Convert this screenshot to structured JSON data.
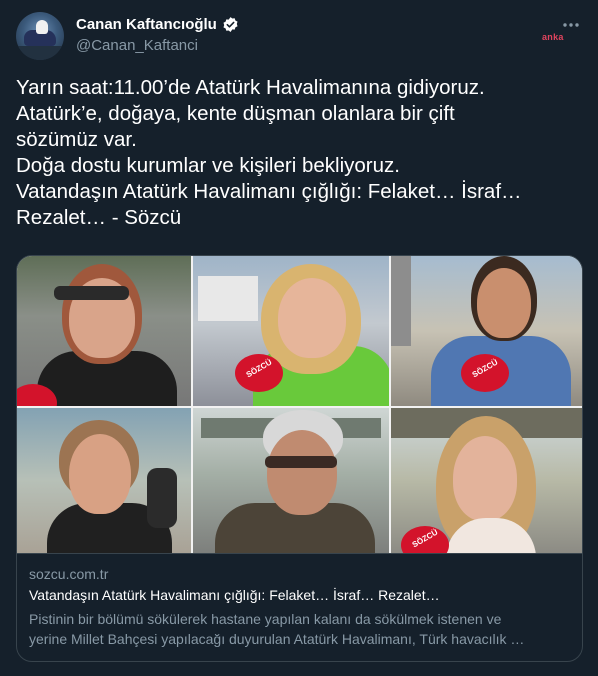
{
  "author": {
    "display_name": "Canan Kaftancıoğlu",
    "handle": "@Canan_Kaftanci",
    "verified": true
  },
  "watermark": "anka",
  "tweet": {
    "lines": [
      "Yarın saat:11.00’de Atatürk Havalimanına gidiyoruz.",
      "Atatürk’e, doğaya, kente düşman olanlara bir çift",
      "sözümüz var.",
      "Doğa dostu kurumlar ve kişileri bekliyoruz.",
      "Vatandaşın Atatürk Havalimanı çığlığı: Felaket… İsraf…",
      "Rezalet… - Sözcü"
    ]
  },
  "link_card": {
    "image_mic_label": "SÖZCÜ",
    "domain": "sozcu.com.tr",
    "title": "Vatandaşın Atatürk Havalimanı çığlığı: Felaket… İsraf… Rezalet…",
    "description_line1": "Pistinin bir bölümü sökülerek hastane yapılan kalanı da sökülmek istenen ve",
    "description_line2": "yerine Millet Bahçesi yapılacağı duyurulan Atatürk Havalimanı, Türk havacılık …"
  },
  "colors": {
    "background": "#15202b",
    "secondary_text": "#8899a6",
    "verified": "#ffffff",
    "border": "#38444d",
    "brand_red": "#d3132b"
  },
  "icons": [
    "verified-badge-icon",
    "more-options-icon"
  ]
}
